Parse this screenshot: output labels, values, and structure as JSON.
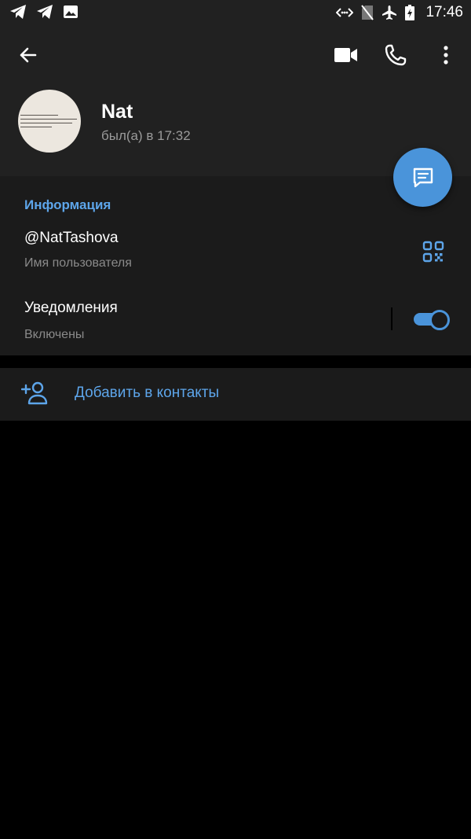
{
  "status_bar": {
    "time": "17:46",
    "left_icons": [
      "telegram-icon",
      "telegram-icon",
      "image-icon"
    ],
    "right_icons": [
      "data-saver-icon",
      "no-sim-icon",
      "airplane-icon",
      "battery-charging-icon"
    ]
  },
  "header": {
    "back_icon": "arrow-left-icon",
    "actions": [
      "video-call-icon",
      "phone-icon",
      "more-vert-icon"
    ]
  },
  "profile": {
    "name": "Nat",
    "last_seen": "был(а) в 17:32"
  },
  "fab": {
    "icon": "message-icon"
  },
  "info": {
    "section_title": "Информация",
    "username": "@NatTashova",
    "username_label": "Имя пользователя",
    "notifications_title": "Уведомления",
    "notifications_status": "Включены",
    "notifications_enabled": true
  },
  "actions": {
    "add_contact": "Добавить в контакты"
  },
  "colors": {
    "accent": "#5da5ea",
    "fab": "#4a94da",
    "header_bg": "#212121",
    "section_bg": "#1b1b1b",
    "background": "#000000"
  }
}
